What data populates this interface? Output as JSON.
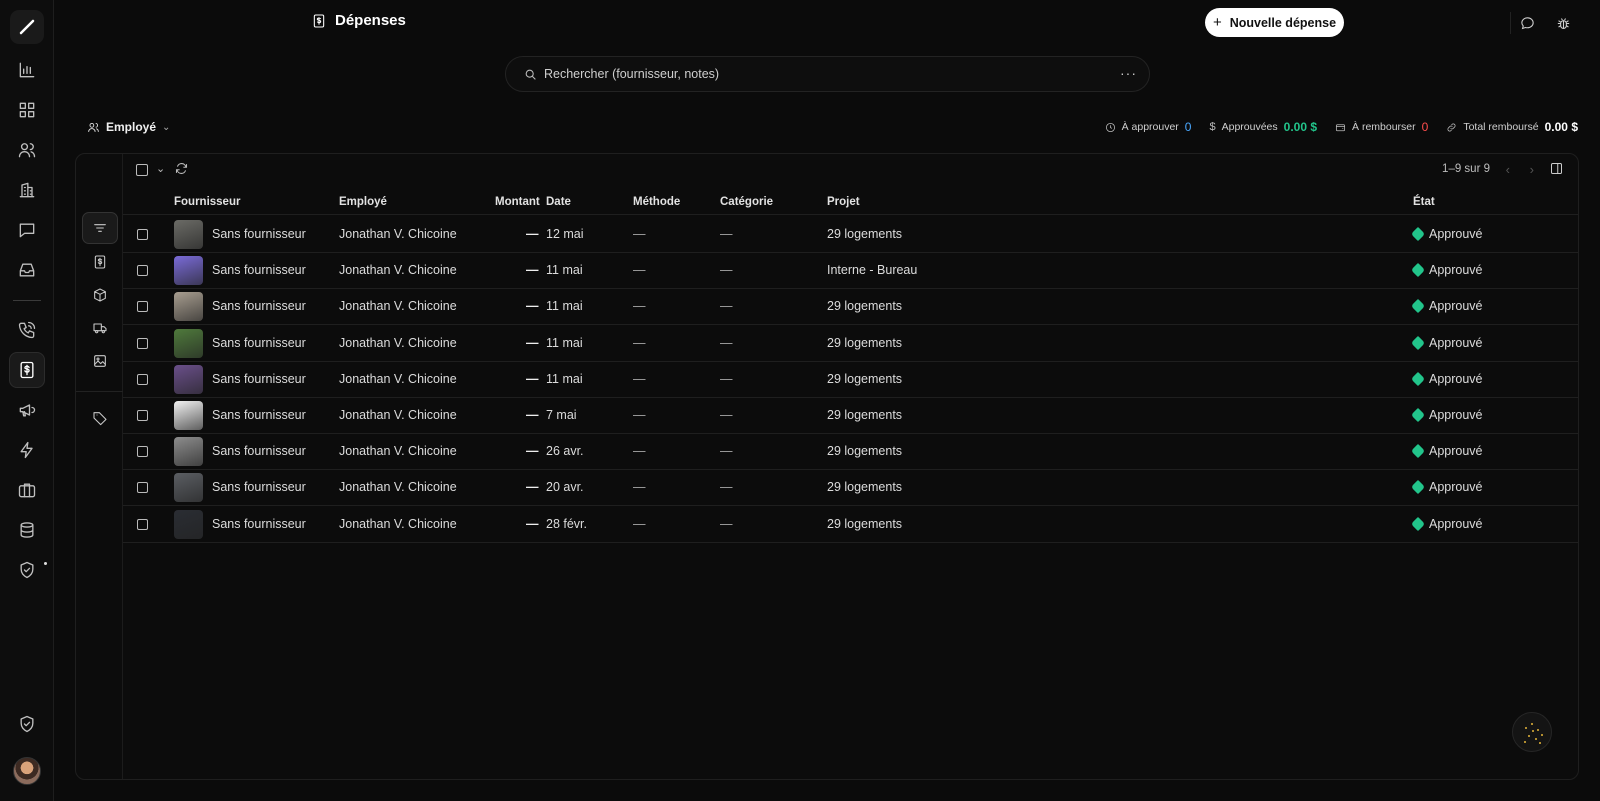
{
  "header": {
    "title": "Dépenses",
    "new_button": "Nouvelle dépense"
  },
  "search": {
    "placeholder": "Rechercher (fournisseur, notes)",
    "more": "···"
  },
  "filter": {
    "employee_label": "Employé"
  },
  "stats": [
    {
      "label": "À approuver",
      "value": "0",
      "color": "#4aa8ff",
      "icon": "clock-icon"
    },
    {
      "label": "Approuvées",
      "value": "0.00 $",
      "color": "#22c58b",
      "icon": "dollar-icon"
    },
    {
      "label": "À rembourser",
      "value": "0",
      "color": "#ff4d4d",
      "icon": "wallet-icon"
    },
    {
      "label": "Total remboursé",
      "value": "0.00 $",
      "color": "#ffffff",
      "icon": "link-icon"
    }
  ],
  "pager": {
    "text": "1–9 sur 9"
  },
  "columns": {
    "supplier": "Fournisseur",
    "employee": "Employé",
    "amount": "Montant",
    "date": "Date",
    "method": "Méthode",
    "category": "Catégorie",
    "project": "Projet",
    "status": "État"
  },
  "rows": [
    {
      "supplier": "Sans fournisseur",
      "employee": "Jonathan V. Chicoine",
      "amount": "—",
      "date": "12 mai",
      "method": "—",
      "category": "—",
      "project": "29 logements",
      "status": "Approuvé",
      "thumb": "#6b6b66"
    },
    {
      "supplier": "Sans fournisseur",
      "employee": "Jonathan V. Chicoine",
      "amount": "—",
      "date": "11 mai",
      "method": "—",
      "category": "—",
      "project": "Interne - Bureau",
      "status": "Approuvé",
      "thumb": "#7a6bd8"
    },
    {
      "supplier": "Sans fournisseur",
      "employee": "Jonathan V. Chicoine",
      "amount": "—",
      "date": "11 mai",
      "method": "—",
      "category": "—",
      "project": "29 logements",
      "status": "Approuvé",
      "thumb": "#a89e90"
    },
    {
      "supplier": "Sans fournisseur",
      "employee": "Jonathan V. Chicoine",
      "amount": "—",
      "date": "11 mai",
      "method": "—",
      "category": "—",
      "project": "29 logements",
      "status": "Approuvé",
      "thumb": "#4f7a3c"
    },
    {
      "supplier": "Sans fournisseur",
      "employee": "Jonathan V. Chicoine",
      "amount": "—",
      "date": "11 mai",
      "method": "—",
      "category": "—",
      "project": "29 logements",
      "status": "Approuvé",
      "thumb": "#6a4f8a"
    },
    {
      "supplier": "Sans fournisseur",
      "employee": "Jonathan V. Chicoine",
      "amount": "—",
      "date": "7 mai",
      "method": "—",
      "category": "—",
      "project": "29 logements",
      "status": "Approuvé",
      "thumb": "#f2f2f2"
    },
    {
      "supplier": "Sans fournisseur",
      "employee": "Jonathan V. Chicoine",
      "amount": "—",
      "date": "26 avr.",
      "method": "—",
      "category": "—",
      "project": "29 logements",
      "status": "Approuvé",
      "thumb": "#8d8d8d"
    },
    {
      "supplier": "Sans fournisseur",
      "employee": "Jonathan V. Chicoine",
      "amount": "—",
      "date": "20 avr.",
      "method": "—",
      "category": "—",
      "project": "29 logements",
      "status": "Approuvé",
      "thumb": "#5b5e63"
    },
    {
      "supplier": "Sans fournisseur",
      "employee": "Jonathan V. Chicoine",
      "amount": "—",
      "date": "28 févr.",
      "method": "—",
      "category": "—",
      "project": "29 logements",
      "status": "Approuvé",
      "thumb": "#2a2d33"
    }
  ],
  "colors": {
    "accent": "#22c58b",
    "background": "#0b0b0b"
  }
}
